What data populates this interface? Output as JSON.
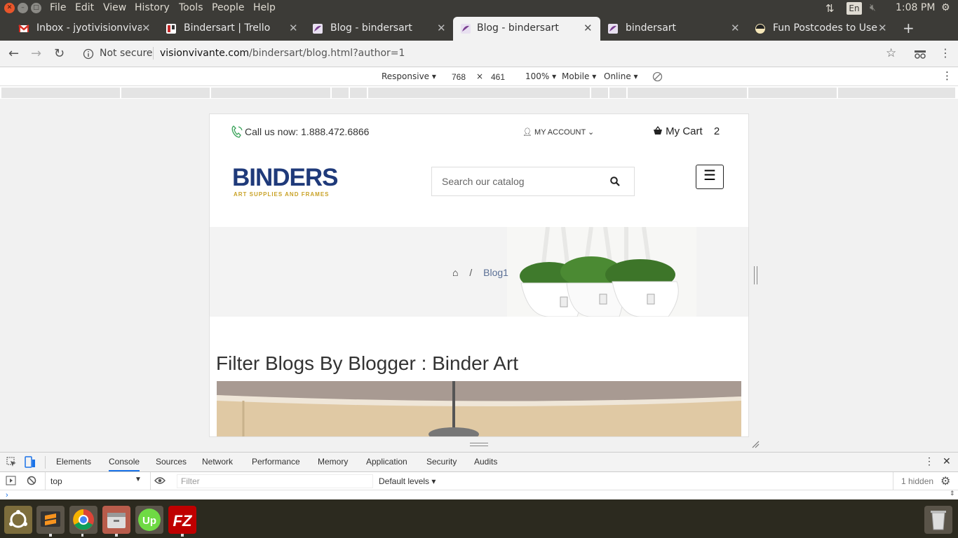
{
  "menubar": {
    "items": [
      "File",
      "Edit",
      "View",
      "History",
      "Tools",
      "People",
      "Help"
    ],
    "lang": "En",
    "clock": "1:08 PM"
  },
  "tabs": [
    {
      "title": "Inbox - jyotivisionvivante",
      "icon": "gmail-icon"
    },
    {
      "title": "Bindersart | Trello",
      "icon": "trello-icon"
    },
    {
      "title": "Blog - bindersart",
      "icon": "bindersart-favicon"
    },
    {
      "title": "Blog - bindersart",
      "icon": "bindersart-favicon",
      "active": true
    },
    {
      "title": "bindersart",
      "icon": "bindersart-favicon"
    },
    {
      "title": "Fun Postcodes to Use",
      "icon": "site-favicon"
    }
  ],
  "address": {
    "security": "Not secure",
    "host": "visionvivante.com",
    "path": "/bindersart/blog.html?author=1"
  },
  "device_toolbar": {
    "device": "Responsive",
    "width": "768",
    "times": "×",
    "height": "461",
    "zoom": "100%",
    "mode": "Mobile",
    "network": "Online"
  },
  "page": {
    "call_us": "Call us now: 1.888.472.6866",
    "my_account": "MY ACCOUNT",
    "my_cart": "My Cart",
    "cart_count": "2",
    "logo_text": "BINDERS",
    "logo_tagline": "ART SUPPLIES AND FRAMES",
    "search_placeholder": "Search our catalog",
    "breadcrumb_sep": "/",
    "breadcrumb_current": "Blog1",
    "heading": "Filter Blogs By Blogger : Binder Art"
  },
  "devtools": {
    "tabs": [
      "Elements",
      "Console",
      "Sources",
      "Network",
      "Performance",
      "Memory",
      "Application",
      "Security",
      "Audits"
    ],
    "active_tab": "Console",
    "context": "top",
    "filter_placeholder": "Filter",
    "levels": "Default levels",
    "hidden": "1 hidden"
  },
  "colors": {
    "ubuntu_bar": "#3c3b37",
    "logo_navy": "#1f3a7a",
    "logo_gold": "#c9a227",
    "link": "#5a6f95",
    "devtools_accent": "#1a73e8"
  }
}
